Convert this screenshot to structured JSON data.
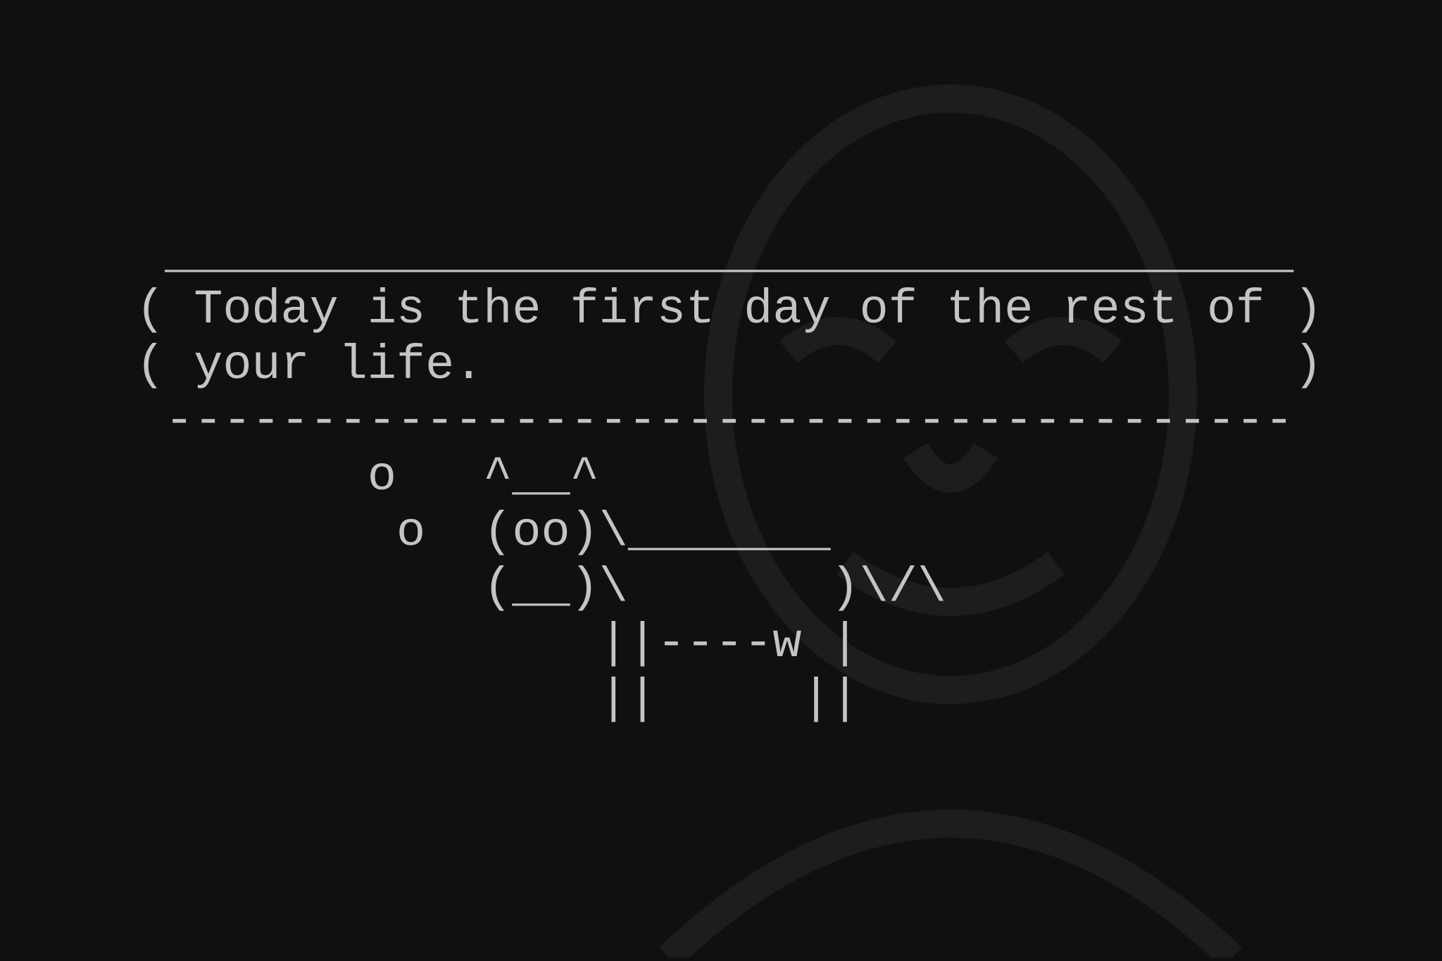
{
  "terminal": {
    "background_color": "#0f1010",
    "text_color": "#c4c4c4",
    "watermark": "faint-face-silhouette",
    "lines": [
      " _______________________________________",
      "( Today is the first day of the rest of )",
      "( your life.                            )",
      " ---------------------------------------",
      "        o   ^__^",
      "         o  (oo)\\_______",
      "            (__)\\       )\\/\\",
      "                ||----w |",
      "                ||     ||"
    ]
  }
}
